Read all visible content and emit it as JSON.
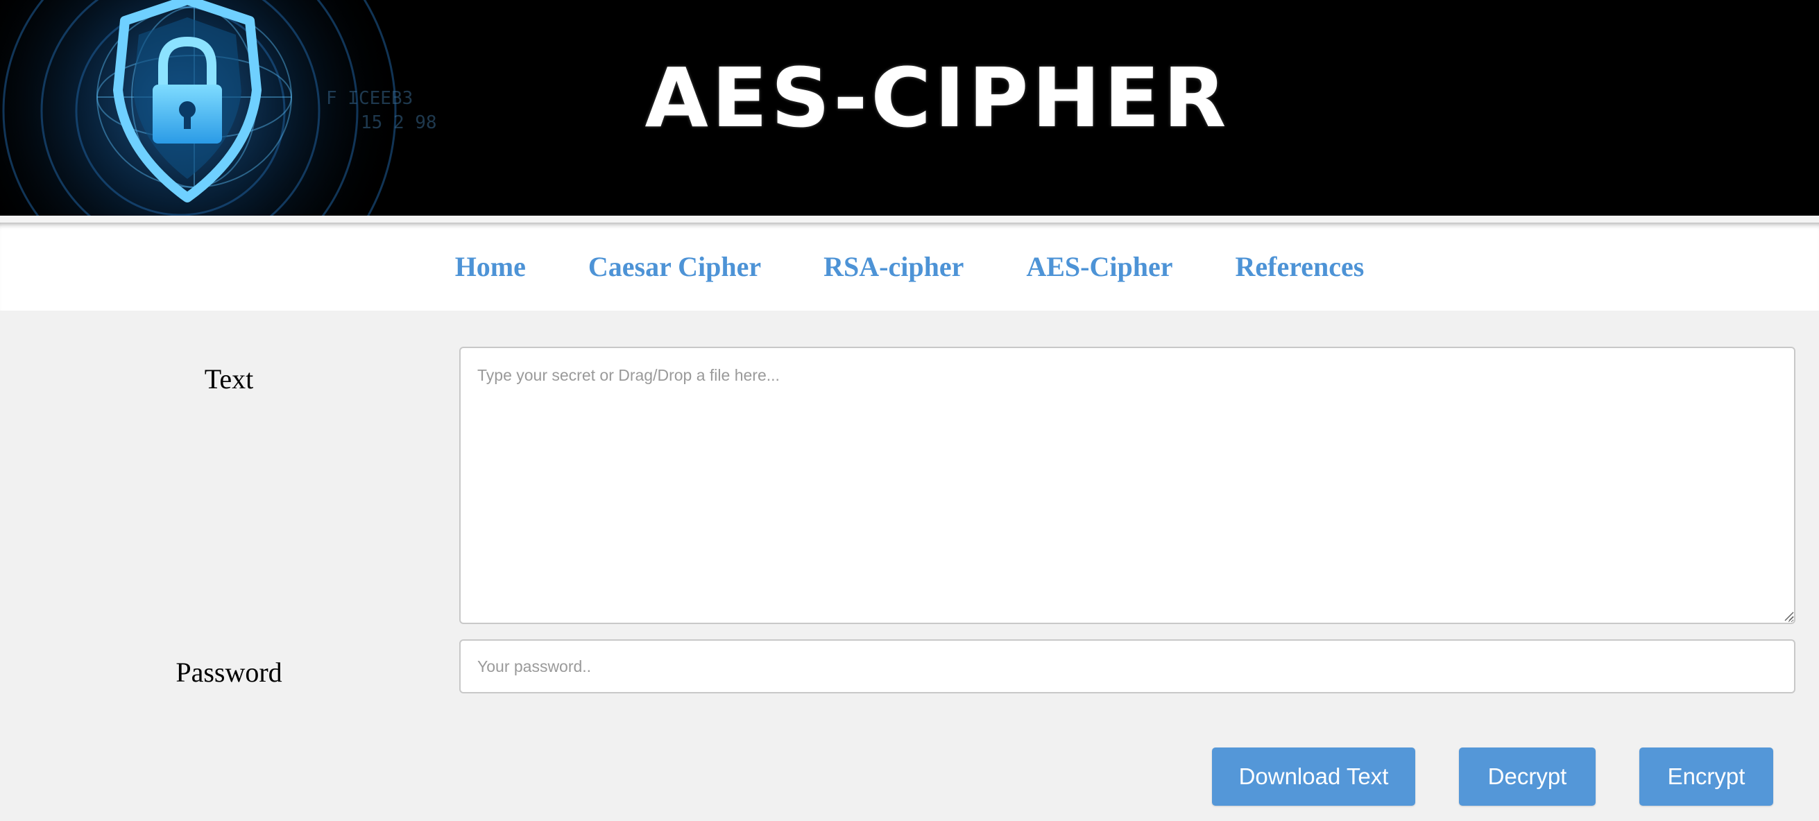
{
  "banner": {
    "title": "AES-CIPHER",
    "art_icon": "padlock-shield-icon"
  },
  "nav": {
    "items": [
      {
        "label": "Home"
      },
      {
        "label": "Caesar Cipher"
      },
      {
        "label": "RSA-cipher"
      },
      {
        "label": "AES-Cipher"
      },
      {
        "label": "References"
      }
    ]
  },
  "form": {
    "text_label": "Text",
    "text_placeholder": "Type your secret or Drag/Drop a file here...",
    "text_value": "",
    "password_label": "Password",
    "password_placeholder": "Your password..",
    "password_value": ""
  },
  "buttons": {
    "download_label": "Download Text",
    "decrypt_label": "Decrypt",
    "encrypt_label": "Encrypt"
  },
  "colors": {
    "banner_bg": "#000000",
    "nav_link": "#4d93d6",
    "button_bg": "#5497d8",
    "page_bg": "#f1f1f1"
  }
}
